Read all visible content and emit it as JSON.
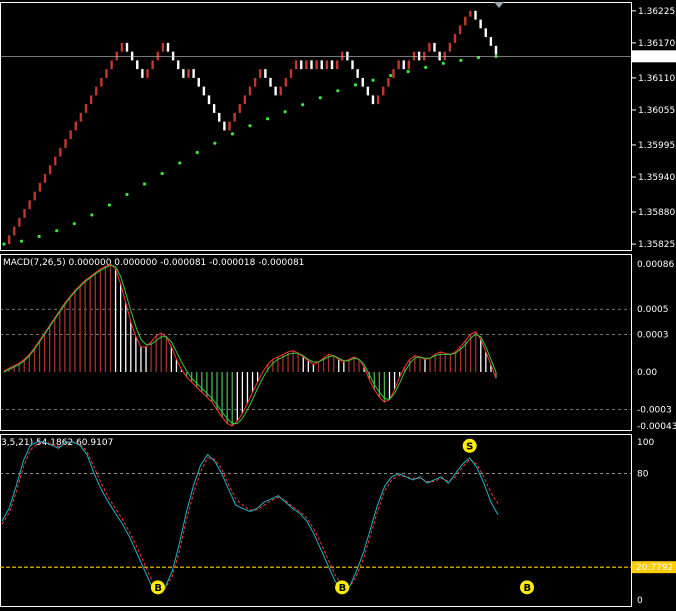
{
  "colors": {
    "background": "#000000",
    "border": "#ffffff",
    "grid": "#c0c0c0",
    "renko_up": "#c0392b",
    "renko_down": "#ffffff",
    "moving_average": "#39e639",
    "macd_hist_pos_bull": "#a0332b",
    "macd_hist_pos_bear": "#ffffff",
    "macd_hist_neg_bull": "#ffffff",
    "macd_hist_neg_bear": "#4caf50",
    "macd_main": "#ff3333",
    "macd_signal": "#33cc33",
    "stoch_main": "#1fb5c8",
    "stoch_signal": "#ff3333",
    "stoch_level": "#ffcc00",
    "signal_badge": "#ffee00",
    "price_marker": "#ffffff",
    "level_marker": "#ffcc00"
  },
  "chart_data": [
    {
      "type": "line",
      "title": "",
      "series": [
        {
          "values": [
            1.35825,
            1.3584,
            1.35855,
            1.3587,
            1.35885,
            1.359,
            1.35915,
            1.3593,
            1.35945,
            1.3596,
            1.35975,
            1.3599,
            1.36005,
            1.3602,
            1.36035,
            1.3605,
            1.36065,
            1.3608,
            1.36095,
            1.3611,
            1.36125,
            1.3614,
            1.36155,
            1.3617,
            1.36155,
            1.3614,
            1.36125,
            1.3611,
            1.36125,
            1.3614,
            1.36155,
            1.3617,
            1.36155,
            1.3614,
            1.36125,
            1.3611,
            1.36125,
            1.3611,
            1.36095,
            1.3608,
            1.36065,
            1.3605,
            1.36035,
            1.3602,
            1.36035,
            1.3605,
            1.36065,
            1.3608,
            1.36095,
            1.3611,
            1.36125,
            1.3611,
            1.36095,
            1.3608,
            1.36095,
            1.3611,
            1.36125,
            1.3614,
            1.36125,
            1.3614,
            1.36125,
            1.3614,
            1.36125,
            1.3614,
            1.36125,
            1.3614,
            1.36155,
            1.3614,
            1.36125,
            1.3611,
            1.36095,
            1.3608,
            1.36065,
            1.3608,
            1.36095,
            1.3611,
            1.36125,
            1.3614,
            1.36125,
            1.3614,
            1.36155,
            1.3614,
            1.36155,
            1.3617,
            1.36155,
            1.3614,
            1.36155,
            1.3617,
            1.36185,
            1.362,
            1.36215,
            1.36225,
            1.3621,
            1.36195,
            1.3618,
            1.36165,
            1.3615
          ]
        },
        {
          "name": "",
          "values": [
            1.35825,
            1.3583,
            1.35838,
            1.35848,
            1.3586,
            1.35875,
            1.35892,
            1.3591,
            1.35928,
            1.35946,
            1.35964,
            1.35982,
            1.35998,
            1.36014,
            1.36028,
            1.3604,
            1.36052,
            1.36064,
            1.36076,
            1.36088,
            1.36098,
            1.36106,
            1.36114,
            1.36121,
            1.36128,
            1.36135,
            1.3614,
            1.36145,
            1.36147
          ]
        }
      ],
      "y_ticks": [
        "1.36225",
        "1.36170",
        "1.36110",
        "1.36055",
        "1.35995",
        "1.35940",
        "1.35880",
        "1.35825"
      ],
      "ylim": [
        1.3582,
        1.36235
      ],
      "current_price": "1.36147"
    },
    {
      "type": "bar",
      "title": "MACD(7,26,5) 0.000000 0.000000 -0.000081 -0.000018 -0.000081",
      "series": [
        {
          "name": "",
          "values": [
            1e-05,
            3e-05,
            5e-05,
            7e-05,
            0.0001,
            0.00014,
            0.00019,
            0.00025,
            0.00031,
            0.00037,
            0.00043,
            0.00049,
            0.00055,
            0.0006,
            0.00065,
            0.00069,
            0.00073,
            0.00076,
            0.00079,
            0.00082,
            0.00084,
            0.00086,
            0.00082,
            0.0007,
            0.00055,
            0.0004,
            0.00028,
            0.0002,
            0.0002,
            0.00024,
            0.00029,
            0.00031,
            0.00028,
            0.0002,
            0.0001,
            2e-05,
            -4e-05,
            -8e-05,
            -0.00012,
            -0.00016,
            -0.0002,
            -0.00024,
            -0.0003,
            -0.00036,
            -0.00041,
            -0.00043,
            -0.00039,
            -0.00033,
            -0.00025,
            -0.00016,
            -8e-05,
            0.0,
            6e-05,
            0.0001,
            0.00012,
            0.00014,
            0.00016,
            0.00017,
            0.00015,
            0.00012,
            9e-05,
            6e-05,
            8e-05,
            0.00011,
            0.00014,
            0.00013,
            0.0001,
            8e-05,
            0.0001,
            0.00012,
            0.0001,
            4e-05,
            -6e-05,
            -0.00014,
            -0.0002,
            -0.00024,
            -0.00022,
            -0.00014,
            -4e-05,
            4e-05,
            0.0001,
            0.00013,
            0.00012,
            0.0001,
            0.00011,
            0.00014,
            0.00016,
            0.00015,
            0.00014,
            0.00016,
            0.0002,
            0.00025,
            0.0003,
            0.00032,
            0.00026,
            0.00016,
            6e-05,
            -5e-05
          ]
        },
        {
          "name": "",
          "values": [
            0.0,
            2e-05,
            4e-05,
            6e-05,
            9e-05,
            0.00013,
            0.00018,
            0.00024,
            0.0003,
            0.00036,
            0.00042,
            0.00048,
            0.00054,
            0.00059,
            0.00064,
            0.00068,
            0.00072,
            0.00075,
            0.00078,
            0.00081,
            0.00083,
            0.00085,
            0.00084,
            0.00076,
            0.00063,
            0.00049,
            0.00036,
            0.00026,
            0.00022,
            0.00022,
            0.00025,
            0.00028,
            0.00028,
            0.00024,
            0.00016,
            8e-05,
            1e-05,
            -5e-05,
            -9e-05,
            -0.00013,
            -0.00017,
            -0.00021,
            -0.00026,
            -0.00032,
            -0.00037,
            -0.00041,
            -0.00041,
            -0.00037,
            -0.0003,
            -0.00022,
            -0.00013,
            -5e-05,
            2e-05,
            7e-05,
            0.0001,
            0.00012,
            0.00014,
            0.00015,
            0.00015,
            0.00013,
            0.0001,
            8e-05,
            8e-05,
            0.0001,
            0.00012,
            0.00013,
            0.00011,
            9e-05,
            9e-05,
            0.00011,
            0.0001,
            6e-05,
            -2e-05,
            -0.0001,
            -0.00016,
            -0.00021,
            -0.00022,
            -0.00017,
            -9e-05,
            0.0,
            7e-05,
            0.00011,
            0.00012,
            0.00011,
            0.00011,
            0.00013,
            0.00014,
            0.00014,
            0.00014,
            0.00015,
            0.00018,
            0.00022,
            0.00027,
            0.0003,
            0.00028,
            0.0002,
            0.0001,
            0.0
          ]
        }
      ],
      "y_ticks": [
        "0.00086",
        "0.0005",
        "0.0003",
        "0.00",
        "-0.0003",
        "-0.00043"
      ],
      "dashed_levels": [
        0.0005,
        0.0003,
        -0.0003
      ],
      "ylim": [
        -0.00043,
        0.00086
      ]
    },
    {
      "type": "line",
      "title": "3,5,21) 54.1862 60.9107",
      "series": [
        {
          "name": "",
          "values": [
            50,
            58,
            72,
            88,
            98,
            100,
            100,
            98,
            96,
            100,
            100,
            98,
            92,
            80,
            70,
            62,
            55,
            48,
            40,
            30,
            20,
            10,
            5,
            8,
            18,
            35,
            55,
            72,
            85,
            92,
            88,
            80,
            70,
            60,
            58,
            56,
            58,
            62,
            64,
            66,
            62,
            58,
            55,
            50,
            42,
            32,
            22,
            12,
            6,
            8,
            18,
            30,
            45,
            60,
            72,
            78,
            80,
            78,
            76,
            78,
            74,
            76,
            78,
            74,
            80,
            86,
            90,
            84,
            74,
            62,
            54
          ]
        },
        {
          "name": "",
          "values": [
            48,
            55,
            68,
            84,
            95,
            99,
            100,
            99,
            97,
            99,
            100,
            99,
            94,
            84,
            74,
            65,
            58,
            51,
            43,
            34,
            24,
            14,
            7,
            7,
            15,
            30,
            50,
            67,
            81,
            90,
            89,
            83,
            73,
            64,
            60,
            57,
            57,
            60,
            63,
            65,
            63,
            59,
            56,
            52,
            45,
            36,
            26,
            16,
            9,
            8,
            15,
            26,
            41,
            56,
            69,
            76,
            79,
            78,
            77,
            77,
            75,
            75,
            77,
            75,
            78,
            84,
            89,
            86,
            78,
            68,
            61
          ]
        }
      ],
      "y_ticks": [
        "100",
        "80",
        "20.7792",
        "0"
      ],
      "dashed_levels": [
        80,
        20.7792
      ],
      "ylim": [
        0,
        100
      ],
      "signals": [
        "B",
        "B",
        "B",
        "S"
      ]
    }
  ]
}
